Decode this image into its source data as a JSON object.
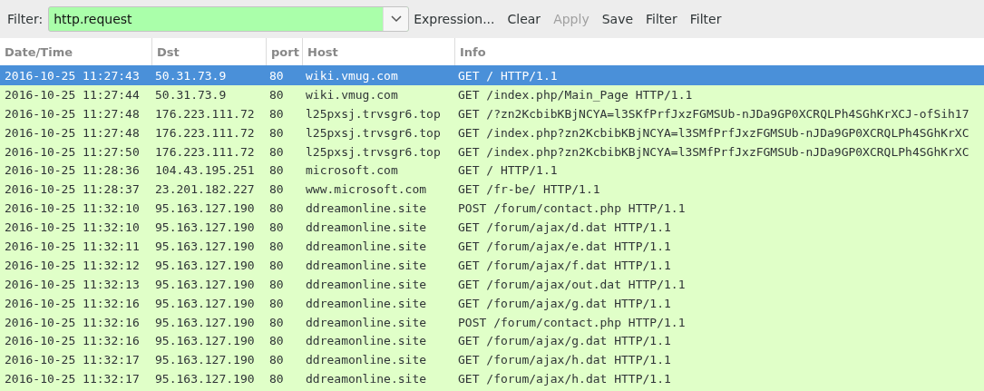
{
  "toolbar": {
    "filter_label": "Filter:",
    "filter_value": "http.request",
    "buttons": [
      {
        "label": "Expression...",
        "disabled": false
      },
      {
        "label": "Clear",
        "disabled": false
      },
      {
        "label": "Apply",
        "disabled": true
      },
      {
        "label": "Save",
        "disabled": false
      },
      {
        "label": "Filter",
        "disabled": false
      },
      {
        "label": "Filter",
        "disabled": false
      }
    ]
  },
  "table": {
    "columns": [
      "Date/Time",
      "Dst",
      "port",
      "Host",
      "Info"
    ],
    "rows": [
      {
        "cells": [
          "2016-10-25 11:27:43",
          "50.31.73.9",
          "80",
          "wiki.vmug.com",
          "GET / HTTP/1.1"
        ],
        "selected": true
      },
      {
        "cells": [
          "2016-10-25 11:27:44",
          "50.31.73.9",
          "80",
          "wiki.vmug.com",
          "GET /index.php/Main_Page HTTP/1.1"
        ],
        "selected": false
      },
      {
        "cells": [
          "2016-10-25 11:27:48",
          "176.223.111.72",
          "80",
          "l25pxsj.trvsgr6.top",
          "GET /?zn2KcbibKBjNCYA=l3SKfPrfJxzFGMSUb-nJDa9GP0XCRQLPh4SGhKrXCJ-ofSih17"
        ],
        "selected": false
      },
      {
        "cells": [
          "2016-10-25 11:27:48",
          "176.223.111.72",
          "80",
          "l25pxsj.trvsgr6.top",
          "GET /index.php?zn2KcbibKBjNCYA=l3SMfPrfJxzFGMSUb-nJDa9GP0XCRQLPh4SGhKrXC"
        ],
        "selected": false
      },
      {
        "cells": [
          "2016-10-25 11:27:50",
          "176.223.111.72",
          "80",
          "l25pxsj.trvsgr6.top",
          "GET /index.php?zn2KcbibKBjNCYA=l3SMfPrfJxzFGMSUb-nJDa9GP0XCRQLPh4SGhKrXC"
        ],
        "selected": false
      },
      {
        "cells": [
          "2016-10-25 11:28:36",
          "104.43.195.251",
          "80",
          "microsoft.com",
          "GET / HTTP/1.1"
        ],
        "selected": false
      },
      {
        "cells": [
          "2016-10-25 11:28:37",
          "23.201.182.227",
          "80",
          "www.microsoft.com",
          "GET /fr-be/ HTTP/1.1"
        ],
        "selected": false
      },
      {
        "cells": [
          "2016-10-25 11:32:10",
          "95.163.127.190",
          "80",
          "ddreamonline.site",
          "POST /forum/contact.php HTTP/1.1"
        ],
        "selected": false
      },
      {
        "cells": [
          "2016-10-25 11:32:10",
          "95.163.127.190",
          "80",
          "ddreamonline.site",
          "GET /forum/ajax/d.dat HTTP/1.1"
        ],
        "selected": false
      },
      {
        "cells": [
          "2016-10-25 11:32:11",
          "95.163.127.190",
          "80",
          "ddreamonline.site",
          "GET /forum/ajax/e.dat HTTP/1.1"
        ],
        "selected": false
      },
      {
        "cells": [
          "2016-10-25 11:32:12",
          "95.163.127.190",
          "80",
          "ddreamonline.site",
          "GET /forum/ajax/f.dat HTTP/1.1"
        ],
        "selected": false
      },
      {
        "cells": [
          "2016-10-25 11:32:13",
          "95.163.127.190",
          "80",
          "ddreamonline.site",
          "GET /forum/ajax/out.dat HTTP/1.1"
        ],
        "selected": false
      },
      {
        "cells": [
          "2016-10-25 11:32:16",
          "95.163.127.190",
          "80",
          "ddreamonline.site",
          "GET /forum/ajax/g.dat HTTP/1.1"
        ],
        "selected": false
      },
      {
        "cells": [
          "2016-10-25 11:32:16",
          "95.163.127.190",
          "80",
          "ddreamonline.site",
          "POST /forum/contact.php HTTP/1.1"
        ],
        "selected": false
      },
      {
        "cells": [
          "2016-10-25 11:32:16",
          "95.163.127.190",
          "80",
          "ddreamonline.site",
          "GET /forum/ajax/g.dat HTTP/1.1"
        ],
        "selected": false
      },
      {
        "cells": [
          "2016-10-25 11:32:17",
          "95.163.127.190",
          "80",
          "ddreamonline.site",
          "GET /forum/ajax/h.dat HTTP/1.1"
        ],
        "selected": false
      },
      {
        "cells": [
          "2016-10-25 11:32:17",
          "95.163.127.190",
          "80",
          "ddreamonline.site",
          "GET /forum/ajax/h.dat HTTP/1.1"
        ],
        "selected": false
      }
    ]
  }
}
